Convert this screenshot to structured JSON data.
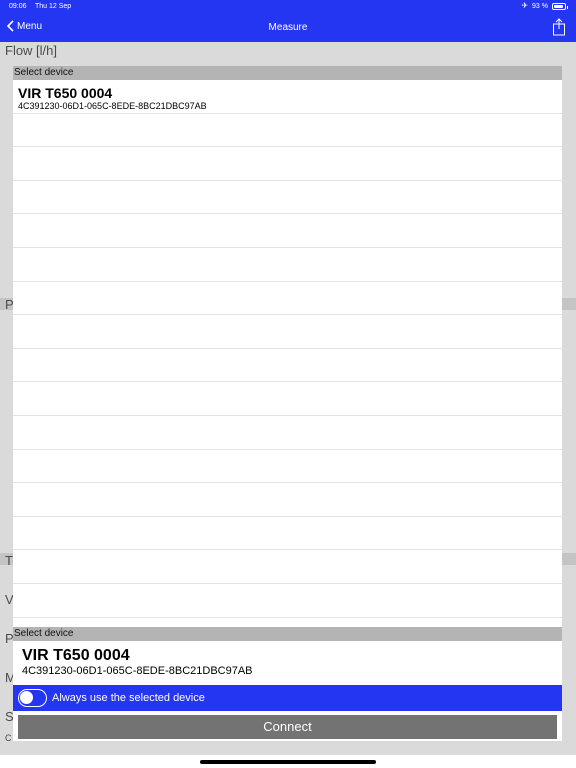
{
  "status_bar": {
    "time": "09:06",
    "date": "Thu 12 Sep",
    "battery_text": "93 %",
    "battery_level": 0.93
  },
  "nav": {
    "back_label": "Menu",
    "title": "Measure"
  },
  "background": {
    "flow_label": "Flow [l/h]"
  },
  "device_list": {
    "header": "Select device",
    "devices": [
      {
        "name": "VIR T650 0004",
        "uuid": "4C391230-06D1-065C-8EDE-8BC21DBC97AB"
      }
    ]
  },
  "selected": {
    "header": "Select device",
    "name": "VIR T650 0004",
    "uuid": "4C391230-06D1-065C-8EDE-8BC21DBC97AB"
  },
  "toggle": {
    "label": "Always use the selected device",
    "on": false
  },
  "connect_label": "Connect",
  "colors": {
    "accent": "#2436f2",
    "header_gray": "#b4b4b4",
    "button_gray": "#737373"
  }
}
